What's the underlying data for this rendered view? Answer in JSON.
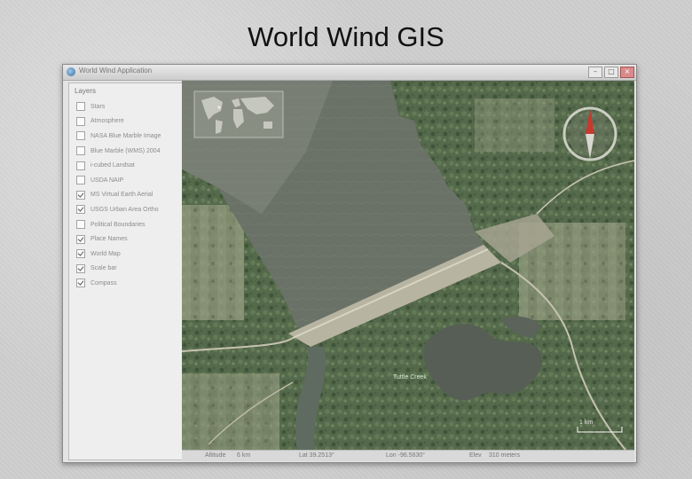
{
  "slide": {
    "title": "World Wind GIS"
  },
  "window": {
    "title": "World Wind Application",
    "controls": {
      "minimize": "–",
      "maximize": "□",
      "close": "×"
    }
  },
  "layer_panel": {
    "heading": "Layers",
    "items": [
      {
        "label": "Stars",
        "checked": false
      },
      {
        "label": "Atmosphere",
        "checked": false
      },
      {
        "label": "NASA Blue Marble Image",
        "checked": false
      },
      {
        "label": "Blue Marble (WMS) 2004",
        "checked": false
      },
      {
        "label": "i-cubed Landsat",
        "checked": false
      },
      {
        "label": "USDA NAIP",
        "checked": false
      },
      {
        "label": "MS Virtual Earth Aerial",
        "checked": true
      },
      {
        "label": "USGS Urban Area Ortho",
        "checked": true
      },
      {
        "label": "Political Boundaries",
        "checked": false
      },
      {
        "label": "Place Names",
        "checked": true
      },
      {
        "label": "World Map",
        "checked": true
      },
      {
        "label": "Scale bar",
        "checked": true
      },
      {
        "label": "Compass",
        "checked": true
      }
    ]
  },
  "map": {
    "scale_label": "1 km",
    "place_label": "Tuttle Creek"
  },
  "status": {
    "altitude_label": "Altitude",
    "altitude_value": "6 km",
    "lat": "Lat 39.2513°",
    "lon": "Lon -96.5630°",
    "elev_label": "Elev",
    "elev_value": "310 meters"
  },
  "colors": {
    "water": "#6b7268",
    "vegetation": "#4f6547",
    "dam": "#b9b6a6",
    "compass_needle": "#c43a2f"
  }
}
